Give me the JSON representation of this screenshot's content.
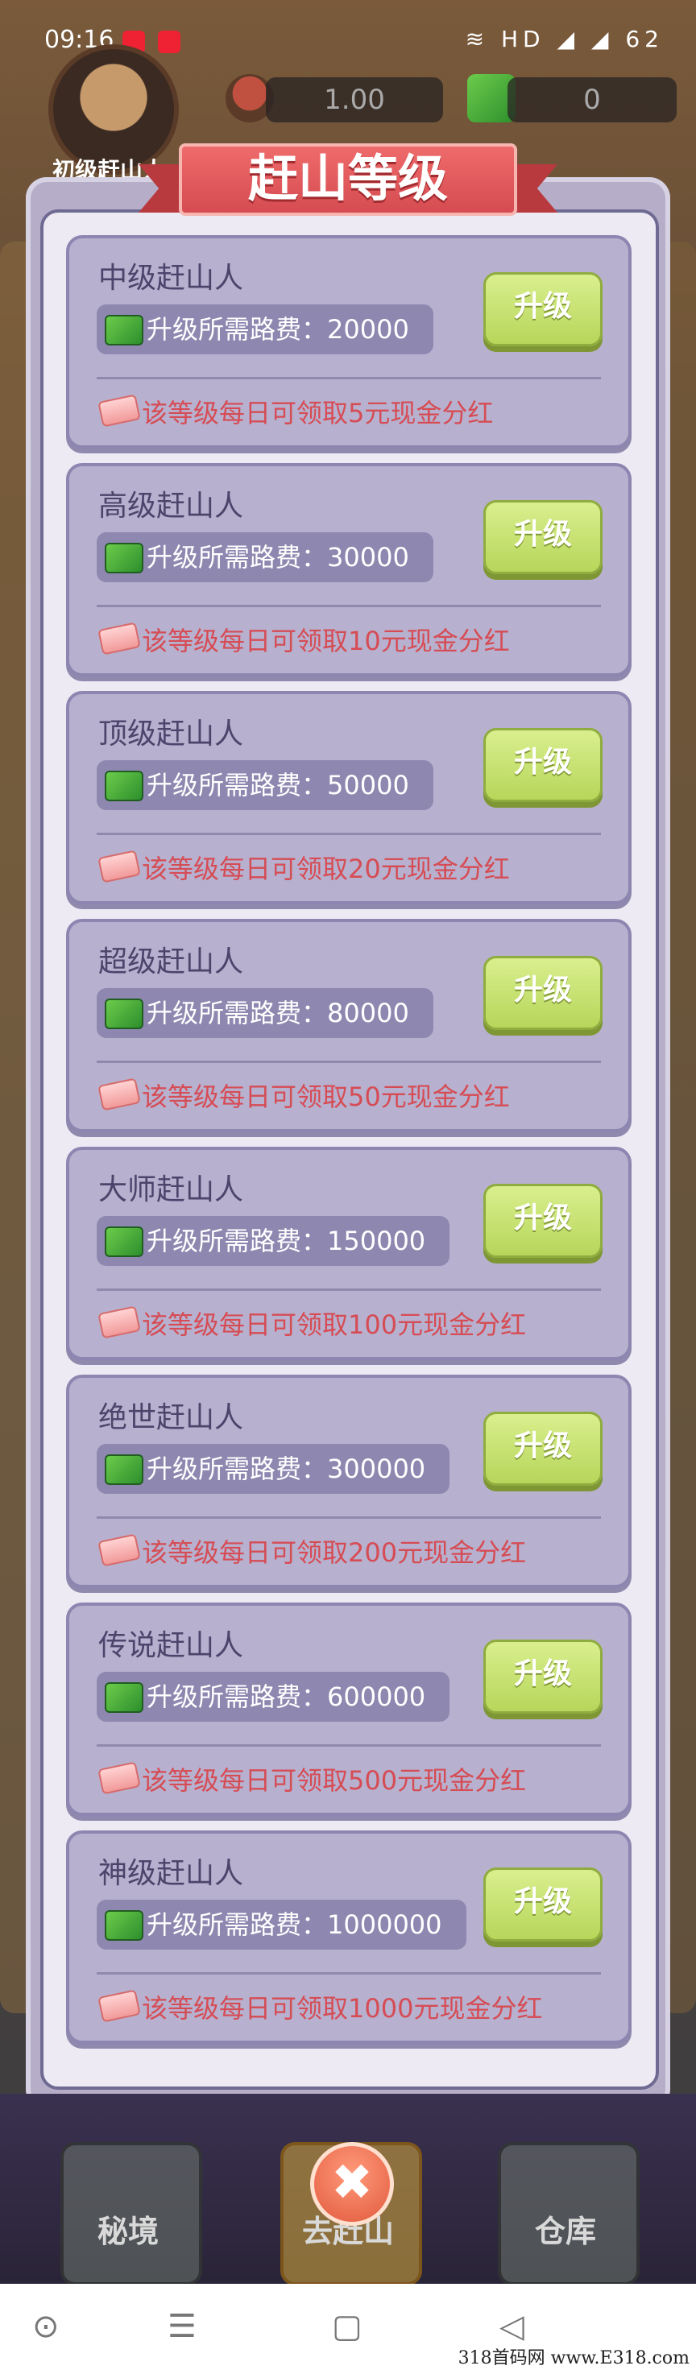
{
  "status_bar": {
    "time": "09:16",
    "right_icons": "≋ HD ◢ ◢ 62"
  },
  "player": {
    "tag": "初级赶山人"
  },
  "resources": [
    {
      "value": "1.00"
    },
    {
      "value": "0"
    }
  ],
  "modal": {
    "title": "赶山等级",
    "upgrade_label": "升级",
    "cards": [
      {
        "name": "中级赶山人",
        "cost": "升级所需路费：20000",
        "reward": "该等级每日可领取5元现金分红"
      },
      {
        "name": "高级赶山人",
        "cost": "升级所需路费：30000",
        "reward": "该等级每日可领取10元现金分红"
      },
      {
        "name": "顶级赶山人",
        "cost": "升级所需路费：50000",
        "reward": "该等级每日可领取20元现金分红"
      },
      {
        "name": "超级赶山人",
        "cost": "升级所需路费：80000",
        "reward": "该等级每日可领取50元现金分红"
      },
      {
        "name": "大师赶山人",
        "cost": "升级所需路费：150000",
        "reward": "该等级每日可领取100元现金分红"
      },
      {
        "name": "绝世赶山人",
        "cost": "升级所需路费：300000",
        "reward": "该等级每日可领取200元现金分红"
      },
      {
        "name": "传说赶山人",
        "cost": "升级所需路费：600000",
        "reward": "该等级每日可领取500元现金分红"
      },
      {
        "name": "神级赶山人",
        "cost": "升级所需路费：1000000",
        "reward": "该等级每日可领取1000元现金分红"
      }
    ]
  },
  "game_nav": {
    "left": "秘境",
    "center": "去赶山",
    "right": "仓库",
    "close": "✖"
  },
  "system_nav": {
    "icons": [
      "circle-icon",
      "menu-icon",
      "square-icon",
      "back-icon"
    ]
  },
  "watermark": "318首码网 www.E318.com"
}
